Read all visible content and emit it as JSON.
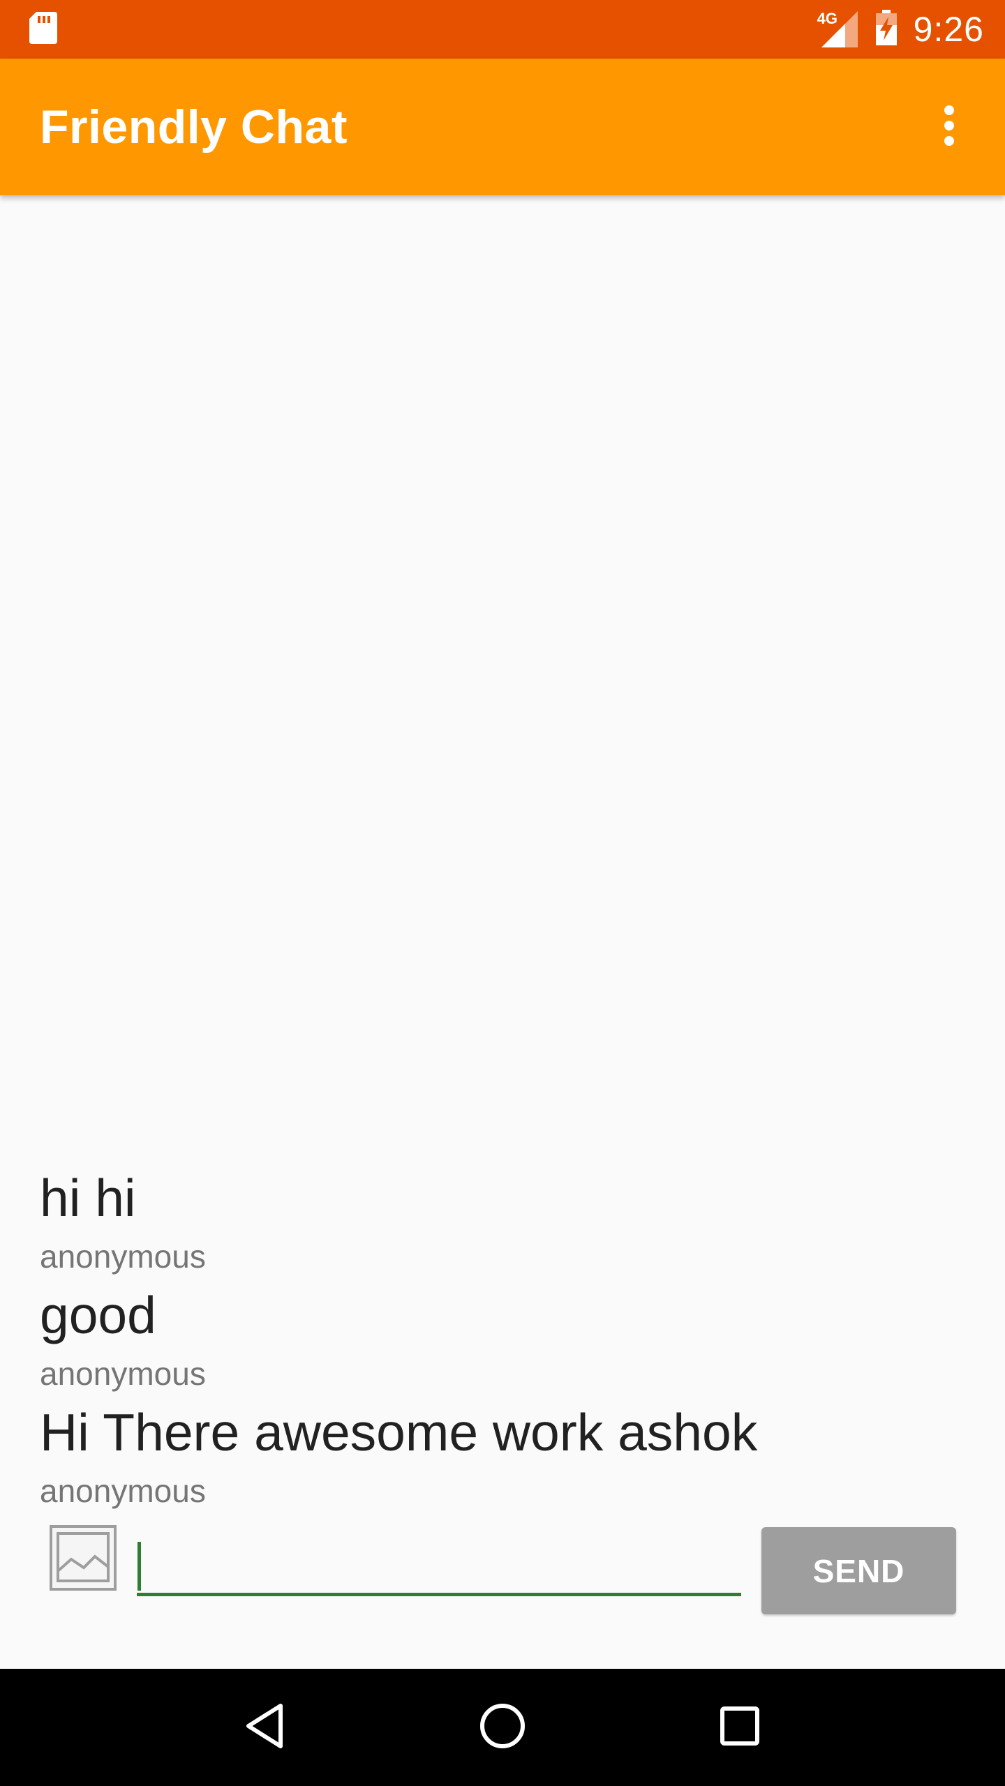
{
  "status_bar": {
    "time": "9:26",
    "network_label": "4G",
    "icons": [
      "sd-card-icon",
      "signal-4g-icon",
      "battery-charging-icon"
    ]
  },
  "app_bar": {
    "title": "Friendly Chat",
    "overflow_icon": "more-vert-icon"
  },
  "messages": [
    {
      "text": "hi hi",
      "author": "anonymous"
    },
    {
      "text": "good",
      "author": "anonymous"
    },
    {
      "text": "Hi There awesome work ashok",
      "author": "anonymous"
    }
  ],
  "composer": {
    "photo_picker_icon": "image-icon",
    "input_value": "",
    "send_label": "SEND"
  },
  "nav_bar": {
    "icons": [
      "back-triangle-icon",
      "home-circle-icon",
      "recents-square-icon"
    ]
  },
  "colors": {
    "status_bar": "#e65100",
    "app_bar": "#ff9800",
    "accent_underline": "#2e7d32",
    "send_button_disabled": "#9e9e9e"
  }
}
